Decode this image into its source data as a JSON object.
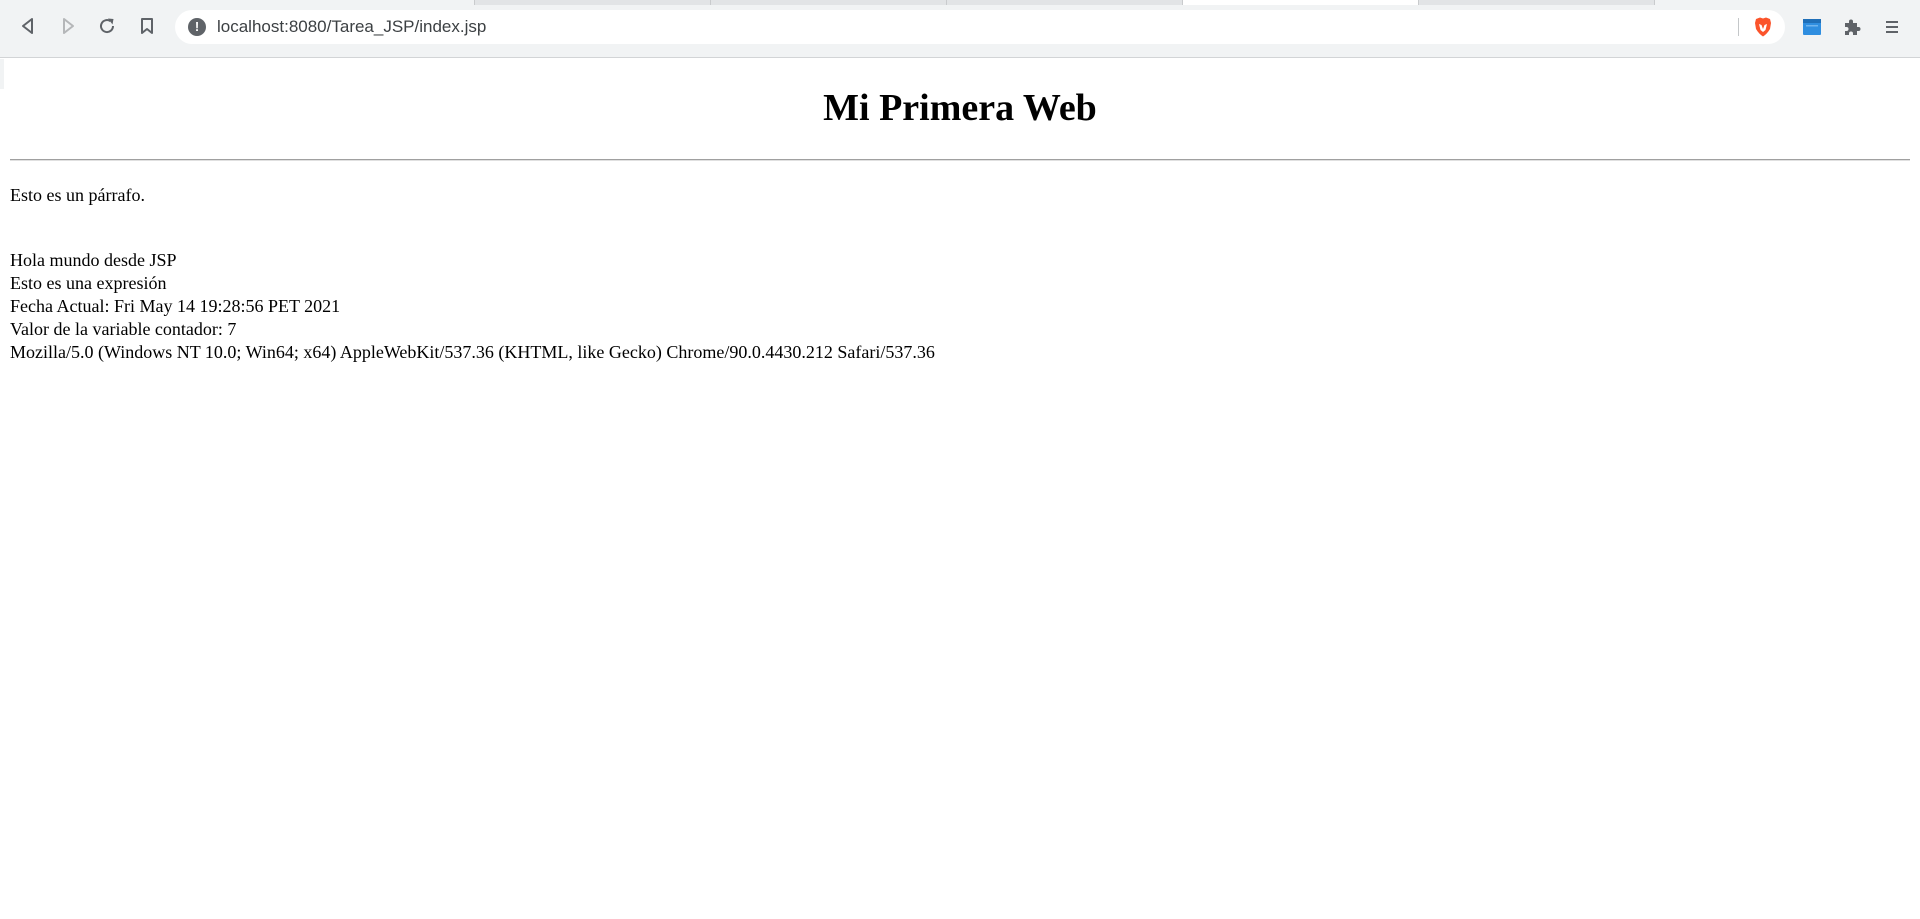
{
  "browser": {
    "address_bar": {
      "url": "localhost:8080/Tarea_JSP/index.jsp"
    },
    "icons": {
      "back": "back-arrow-icon",
      "forward": "forward-arrow-icon",
      "reload": "reload-icon",
      "bookmark": "bookmark-icon",
      "site_info": "info-icon",
      "brave_shields": "brave-lion-icon",
      "extension": "extension-icon",
      "extensions_menu": "puzzle-icon",
      "menu": "hamburger-menu-icon"
    },
    "colors": {
      "toolbar_bg": "#f1f3f4",
      "brave_orange": "#fb542b",
      "extension_blue": "#2f8ee0"
    }
  },
  "page": {
    "heading": "Mi Primera Web",
    "paragraph": "Esto es un párrafo.",
    "lines": [
      "Hola mundo desde JSP",
      "Esto es una expresión",
      "Fecha Actual: Fri May 14 19:28:56 PET 2021",
      "Valor de la variable contador: 7",
      "Mozilla/5.0 (Windows NT 10.0; Win64; x64) AppleWebKit/537.36 (KHTML, like Gecko) Chrome/90.0.4430.212 Safari/537.36"
    ]
  }
}
